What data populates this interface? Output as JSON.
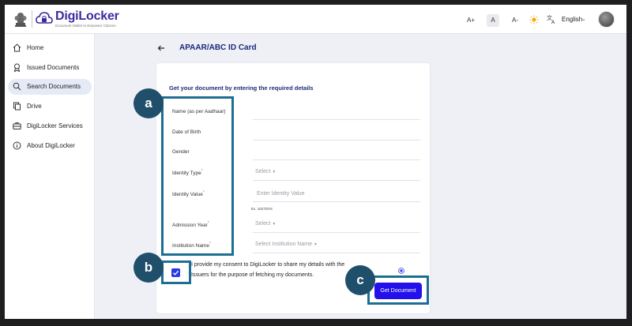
{
  "header": {
    "brand": "DigiLocker",
    "tagline": "Document Wallet to Empower Citizens",
    "font_controls": [
      "A+",
      "A",
      "A-"
    ],
    "language": "English"
  },
  "sidebar": {
    "items": [
      {
        "label": "Home",
        "icon": "home-icon"
      },
      {
        "label": "Issued Documents",
        "icon": "badge-icon"
      },
      {
        "label": "Search Documents",
        "icon": "search-icon",
        "active": true
      },
      {
        "label": "Drive",
        "icon": "copy-icon"
      },
      {
        "label": "DigiLocker Services",
        "icon": "briefcase-icon"
      },
      {
        "label": "About DigiLocker",
        "icon": "info-icon"
      }
    ]
  },
  "main": {
    "title": "APAAR/ABC ID Card",
    "heading": "Get your document by entering the required details",
    "fields": {
      "name": {
        "label": "Name (as per Aadhaar)"
      },
      "dob": {
        "label": "Date of Birth"
      },
      "gender": {
        "label": "Gender"
      },
      "identity_type": {
        "label": "Identity Type",
        "value": "Select"
      },
      "identity_value": {
        "label": "Identity Value",
        "placeholder": "Enter Identity Value",
        "hint": "Ex. 1627DXX"
      },
      "admission_year": {
        "label": "Admission Year",
        "value": "Select"
      },
      "institution_name": {
        "label": "Institution Name",
        "value": "Select Institution Name"
      }
    },
    "consent": "I provide my consent to DigiLocker to share my details with the Issuers for the purpose of fetching my documents.",
    "consent_checked": true,
    "submit_label": "Get Document"
  },
  "annotations": {
    "a": "a",
    "b": "b",
    "c": "c",
    "color": "#1d6e93"
  },
  "colors": {
    "brand": "#3e2aa0",
    "title": "#1e2a78",
    "button": "#2410ea",
    "active_nav": "#e4ebf7"
  }
}
